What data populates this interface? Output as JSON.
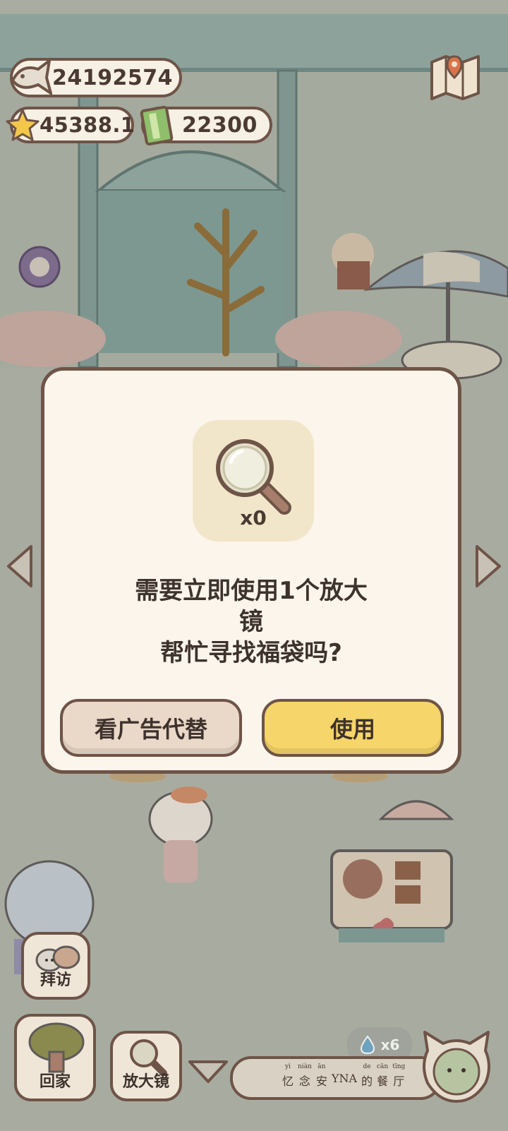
{
  "hud": {
    "fish_coins": "24192574",
    "stars": "45388.1",
    "tickets": "22300"
  },
  "dialog": {
    "item_count": "x0",
    "message_line1": "需要立即使用1个放大",
    "message_line2": "镜",
    "message_line3": "帮忙寻找福袋吗?",
    "btn_watch_ad": "看广告代替",
    "btn_use": "使用"
  },
  "bottom": {
    "visit_label": "拜访",
    "home_label": "回家",
    "magnifier_label": "放大镜",
    "drop_count": "x6",
    "restaurant_name": [
      {
        "py": "yì",
        "hz": "忆"
      },
      {
        "py": "niàn",
        "hz": "念"
      },
      {
        "py": "ān",
        "hz": "安"
      },
      {
        "py": "",
        "hz": "YNA"
      },
      {
        "py": "de",
        "hz": "的"
      },
      {
        "py": "cān",
        "hz": "餐"
      },
      {
        "py": "tīng",
        "hz": "厅"
      }
    ]
  },
  "colors": {
    "border": "#6e5447",
    "dialog_bg": "#fbf5ec",
    "use_button": "#f6d56a",
    "ad_button": "#ead8c8",
    "scene_bg": "#a8aca0"
  },
  "icons": [
    "fish-icon",
    "star-icon",
    "ticket-icon",
    "map-icon",
    "magnifier-icon",
    "water-drop-icon",
    "cat-avatar-icon",
    "chevron-left-icon",
    "chevron-right-icon",
    "chevron-down-icon"
  ]
}
